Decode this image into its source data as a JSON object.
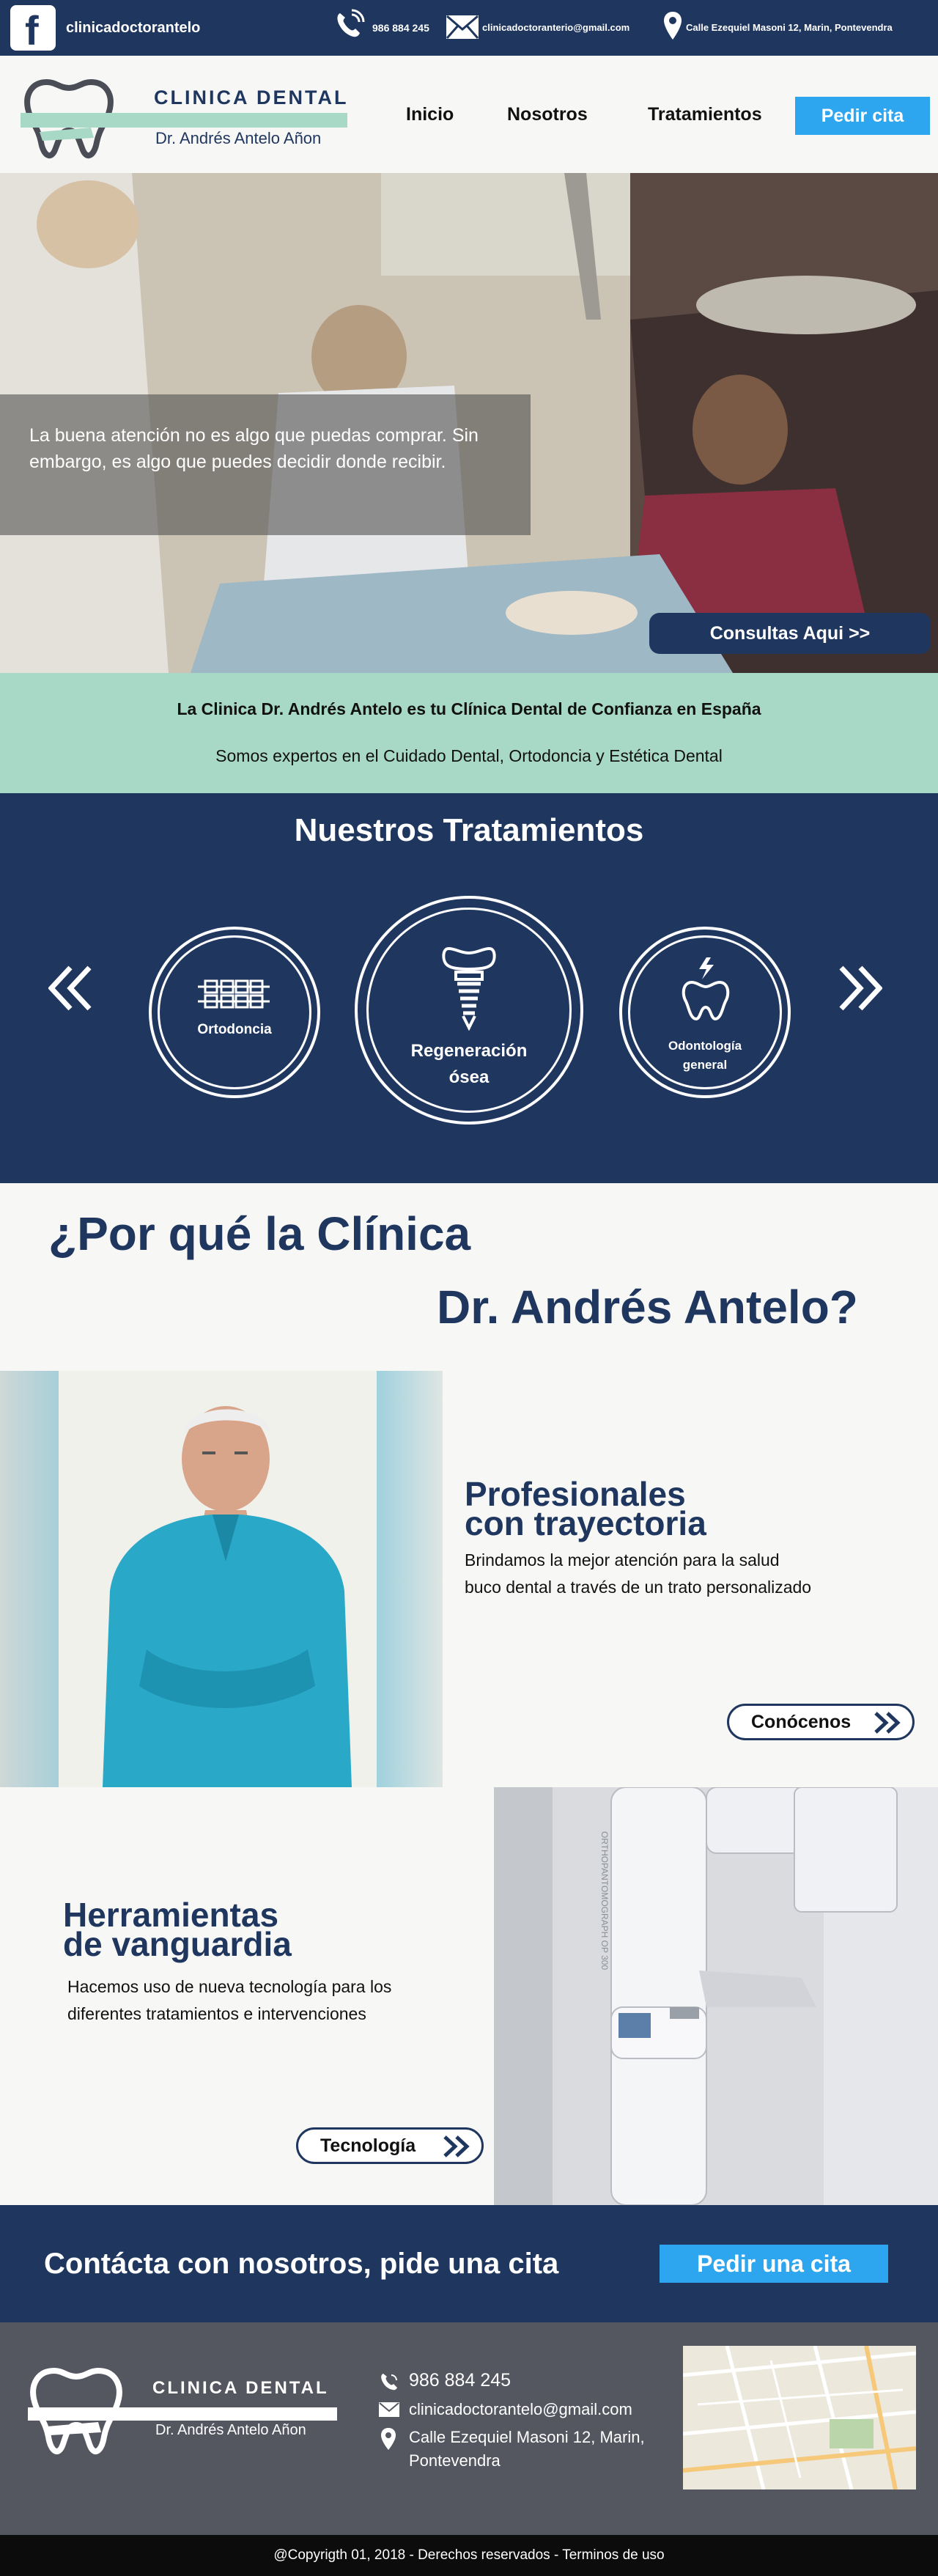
{
  "topbar": {
    "facebook_handle": "clinicadoctorantelo",
    "phone": "986 884 245",
    "email": "clinicadoctoranterio@gmail.com",
    "address": "Calle Ezequiel Masoni 12, Marin, Pontevendra"
  },
  "brand": {
    "name": "CLINICA DENTAL",
    "doctor": "Dr. Andrés Antelo Añon"
  },
  "nav": {
    "items": [
      "Inicio",
      "Nosotros",
      "Tratamientos"
    ],
    "cta": "Pedir cita"
  },
  "hero": {
    "quote": "La buena atención no es algo que puedas comprar. Sin embargo, es algo que puedes decidir donde recibir.",
    "button": "Consultas Aqui >>"
  },
  "intro": {
    "line1": "La Clinica Dr. Andrés Antelo es tu Clínica Dental de Confianza en España",
    "line2": "Somos expertos en el Cuidado Dental, Ortodoncia y Estética Dental"
  },
  "treatments": {
    "title": "Nuestros Tratamientos",
    "items": [
      {
        "label": "Ortodoncia",
        "icon": "braces-icon"
      },
      {
        "label": "Regeneración ósea",
        "icon": "dental-implant-icon"
      },
      {
        "label": "Odontología general",
        "icon": "tooth-pain-icon"
      }
    ]
  },
  "why": {
    "title_line1": "¿Por qué la Clínica",
    "title_line2": "Dr. Andrés Antelo?"
  },
  "professionals": {
    "title_line1": "Profesionales",
    "title_line2": "con trayectoria",
    "body": "Brindamos la mejor atención para la salud buco dental a través de un trato personalizado",
    "button": "Conócenos"
  },
  "tools": {
    "title_line1": "Herramientas",
    "title_line2": "de vanguardia",
    "body": "Hacemos uso de nueva tecnología para los diferentes tratamientos e intervenciones",
    "button": "Tecnología",
    "machine_text": "ORTHOPANTOMOGRAPH OP 300"
  },
  "contact": {
    "text": "Contácta con nosotros, pide una cita",
    "button": "Pedir una cita"
  },
  "footer": {
    "brand_name": "CLINICA DENTAL",
    "brand_doctor": "Dr. Andrés Antelo Añon",
    "phone": "986 884 245",
    "email": "clinicadoctorantelo@gmail.com",
    "address_line1": "Calle Ezequiel Masoni 12, Marin,",
    "address_line2": "Pontevendra",
    "copyright": "@Copyrigth 01, 2018 - Derechos reservados - Terminos de uso"
  },
  "colors": {
    "navy": "#1f365f",
    "accent_blue": "#2ea6ef",
    "mint": "#a8d8c6",
    "footer_gray": "#545660"
  }
}
